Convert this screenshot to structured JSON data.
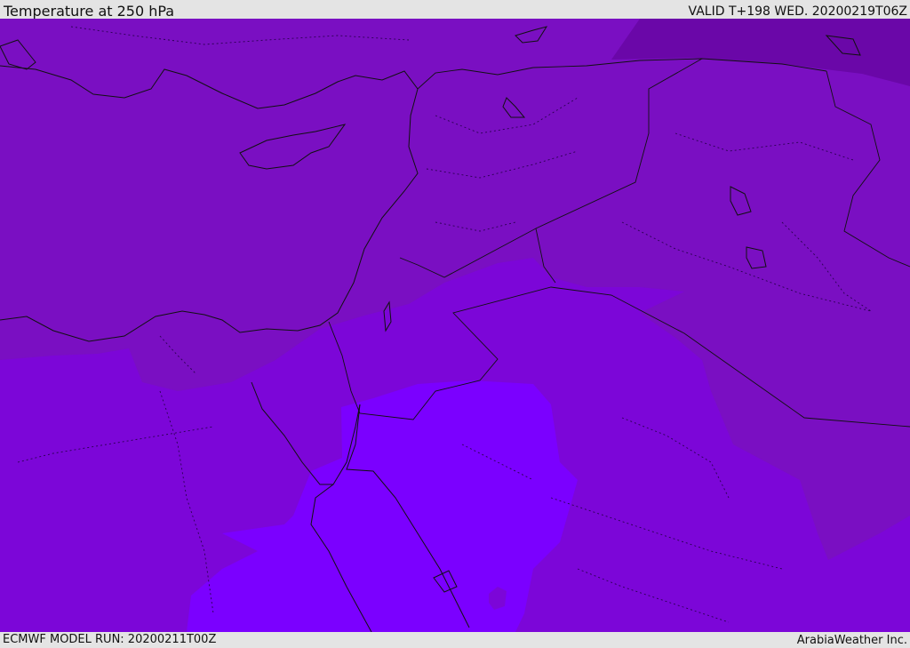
{
  "header": {
    "title": "Temperature at 250 hPa",
    "valid": "VALID T+198 WED. 20200219T06Z"
  },
  "footer": {
    "model_run": "ECMWF MODEL RUN: 20200211T00Z",
    "credit": "ArabiaWeather Inc."
  },
  "colors": {
    "base": "#7a0fc2",
    "cold_zone": "#6a07a8",
    "mid_zone": "#7c06d8",
    "warm_zone": "#7b00ff",
    "boundary": "#111111"
  }
}
